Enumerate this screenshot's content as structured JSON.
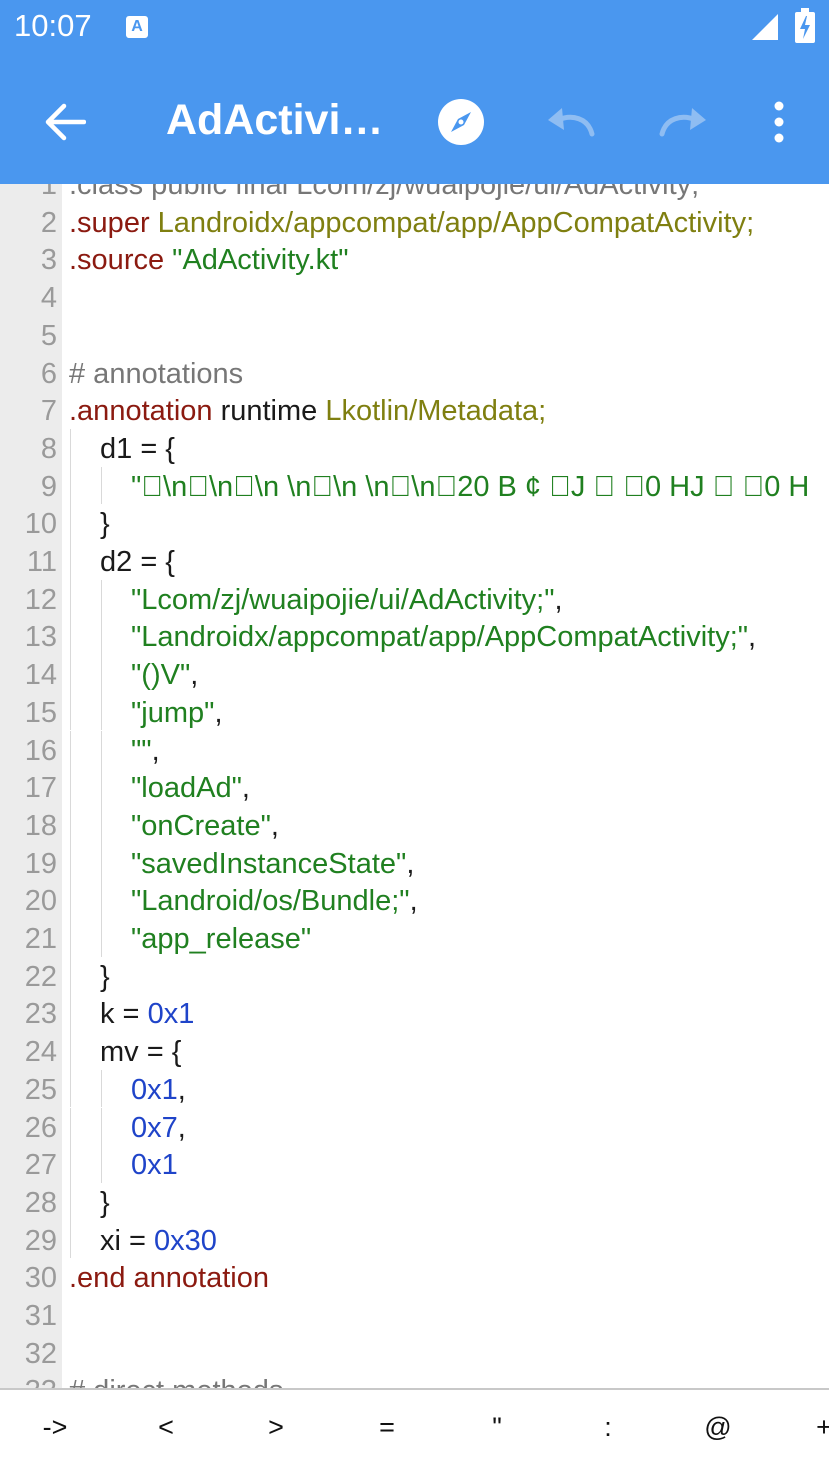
{
  "status_bar": {
    "time": "10:07",
    "notification_icon": "text-notification-icon",
    "signal_icon": "signal-icon",
    "battery_icon": "battery-charging-icon"
  },
  "app_bar": {
    "title": "AdActivity.smali",
    "back_icon": "arrow-left-icon",
    "actions": [
      "compass-icon",
      "undo-icon",
      "redo-icon",
      "more-vert-icon"
    ]
  },
  "colors": {
    "accent": "#4a97ef",
    "keyword": "#8b1a10",
    "type": "#7f7f10",
    "string": "#208020",
    "number": "#1f44c9",
    "comment": "#777777",
    "gutter": "#ececec"
  },
  "editor": {
    "lines": [
      {
        "n": "1",
        "indent": 0,
        "segs": [
          {
            "t": ".class public final Lcom/zj/wuaipojie/ui/AdActivity;",
            "c": "cm"
          }
        ]
      },
      {
        "n": "2",
        "indent": 0,
        "segs": [
          {
            "t": ".super",
            "c": "kw"
          },
          {
            "t": " "
          },
          {
            "t": "Landroidx/appcompat/app/AppCompatActivity;",
            "c": "ty"
          }
        ]
      },
      {
        "n": "3",
        "indent": 0,
        "segs": [
          {
            "t": ".source",
            "c": "kw"
          },
          {
            "t": " "
          },
          {
            "t": "\"AdActivity.kt\"",
            "c": "st"
          }
        ]
      },
      {
        "n": "4",
        "indent": 0,
        "segs": []
      },
      {
        "n": "5",
        "indent": 0,
        "segs": []
      },
      {
        "n": "6",
        "indent": 0,
        "segs": [
          {
            "t": "# annotations",
            "c": "cm"
          }
        ]
      },
      {
        "n": "7",
        "indent": 0,
        "segs": [
          {
            "t": ".annotation",
            "c": "kw"
          },
          {
            "t": " runtime "
          },
          {
            "t": "Lkotlin/Metadata;",
            "c": "ty"
          }
        ]
      },
      {
        "n": "8",
        "indent": 1,
        "segs": [
          {
            "t": "d1 = {"
          }
        ]
      },
      {
        "n": "9",
        "indent": 2,
        "segs": [
          {
            "t": "\"\u0000\\n\u0002\\n\u0002\\n \\n\u0002\\n  \\n\u0002\\n\u000020 B ¢ \u0006J \u0006 \u00060 HJ \u0006 \u00060 H",
            "c": "st"
          }
        ]
      },
      {
        "n": "10",
        "indent": 1,
        "segs": [
          {
            "t": "}"
          }
        ]
      },
      {
        "n": "11",
        "indent": 1,
        "segs": [
          {
            "t": "d2 = {"
          }
        ]
      },
      {
        "n": "12",
        "indent": 2,
        "segs": [
          {
            "t": "\"Lcom/zj/wuaipojie/ui/AdActivity;\"",
            "c": "st"
          },
          {
            "t": ","
          }
        ]
      },
      {
        "n": "13",
        "indent": 2,
        "segs": [
          {
            "t": "\"Landroidx/appcompat/app/AppCompatActivity;\"",
            "c": "st"
          },
          {
            "t": ","
          }
        ]
      },
      {
        "n": "14",
        "indent": 2,
        "segs": [
          {
            "t": "\"()V\"",
            "c": "st"
          },
          {
            "t": ","
          }
        ]
      },
      {
        "n": "15",
        "indent": 2,
        "segs": [
          {
            "t": "\"jump\"",
            "c": "st"
          },
          {
            "t": ","
          }
        ]
      },
      {
        "n": "16",
        "indent": 2,
        "segs": [
          {
            "t": "\"\"",
            "c": "st"
          },
          {
            "t": ","
          }
        ]
      },
      {
        "n": "17",
        "indent": 2,
        "segs": [
          {
            "t": "\"loadAd\"",
            "c": "st"
          },
          {
            "t": ","
          }
        ]
      },
      {
        "n": "18",
        "indent": 2,
        "segs": [
          {
            "t": "\"onCreate\"",
            "c": "st"
          },
          {
            "t": ","
          }
        ]
      },
      {
        "n": "19",
        "indent": 2,
        "segs": [
          {
            "t": "\"savedInstanceState\"",
            "c": "st"
          },
          {
            "t": ","
          }
        ]
      },
      {
        "n": "20",
        "indent": 2,
        "segs": [
          {
            "t": "\"Landroid/os/Bundle;\"",
            "c": "st"
          },
          {
            "t": ","
          }
        ]
      },
      {
        "n": "21",
        "indent": 2,
        "segs": [
          {
            "t": "\"app_release\"",
            "c": "st"
          }
        ]
      },
      {
        "n": "22",
        "indent": 1,
        "segs": [
          {
            "t": "}"
          }
        ]
      },
      {
        "n": "23",
        "indent": 1,
        "segs": [
          {
            "t": "k = "
          },
          {
            "t": "0x1",
            "c": "nu"
          }
        ]
      },
      {
        "n": "24",
        "indent": 1,
        "segs": [
          {
            "t": "mv = {"
          }
        ]
      },
      {
        "n": "25",
        "indent": 2,
        "segs": [
          {
            "t": "0x1",
            "c": "nu"
          },
          {
            "t": ","
          }
        ]
      },
      {
        "n": "26",
        "indent": 2,
        "segs": [
          {
            "t": "0x7",
            "c": "nu"
          },
          {
            "t": ","
          }
        ]
      },
      {
        "n": "27",
        "indent": 2,
        "segs": [
          {
            "t": "0x1",
            "c": "nu"
          }
        ]
      },
      {
        "n": "28",
        "indent": 1,
        "segs": [
          {
            "t": "}"
          }
        ]
      },
      {
        "n": "29",
        "indent": 1,
        "segs": [
          {
            "t": "xi = "
          },
          {
            "t": "0x30",
            "c": "nu"
          }
        ]
      },
      {
        "n": "30",
        "indent": 0,
        "segs": [
          {
            "t": ".end annotation",
            "c": "kw"
          }
        ]
      },
      {
        "n": "31",
        "indent": 0,
        "segs": []
      },
      {
        "n": "32",
        "indent": 0,
        "segs": []
      },
      {
        "n": "33",
        "indent": 0,
        "segs": [
          {
            "t": "# direct methods",
            "c": "cm"
          }
        ]
      }
    ]
  },
  "symbol_bar": {
    "keys": [
      "->",
      "<",
      ">",
      "=",
      "\"",
      ":",
      "@",
      "+"
    ]
  }
}
